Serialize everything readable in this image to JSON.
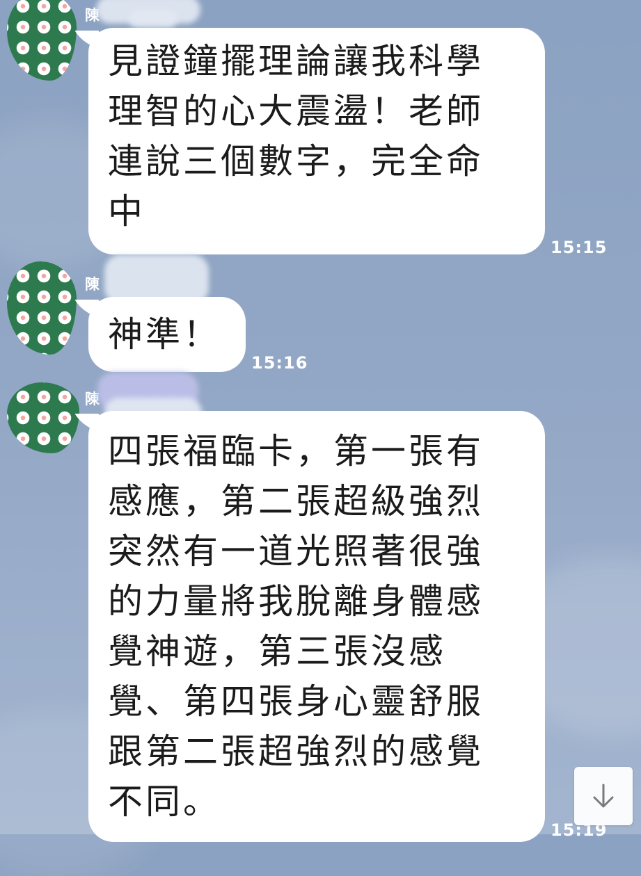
{
  "chat": {
    "messages": [
      {
        "sender": "陳",
        "text": "見證鐘擺理論讓我科學\n理智的心大震盪！老師\n連說三個數字，完全命\n中",
        "time": "15:15"
      },
      {
        "sender": "陳",
        "text": "神準！",
        "time": "15:16"
      },
      {
        "sender": "陳",
        "text": "四張福臨卡，第一張有\n感應，第二張超級強烈\n突然有一道光照著很強\n的力量將我脫離身體感\n覺神遊，第三張沒感\n覺、第四張身心靈舒服\n跟第二張超強烈的感覺\n不同。",
        "time": "15:19"
      }
    ]
  },
  "scroll_button": {
    "icon": "arrow-down-icon"
  },
  "colors": {
    "background": "#8ca2c2",
    "bubble": "#ffffff",
    "avatar": "#2d7a4e",
    "text": "#1b1b1b"
  }
}
